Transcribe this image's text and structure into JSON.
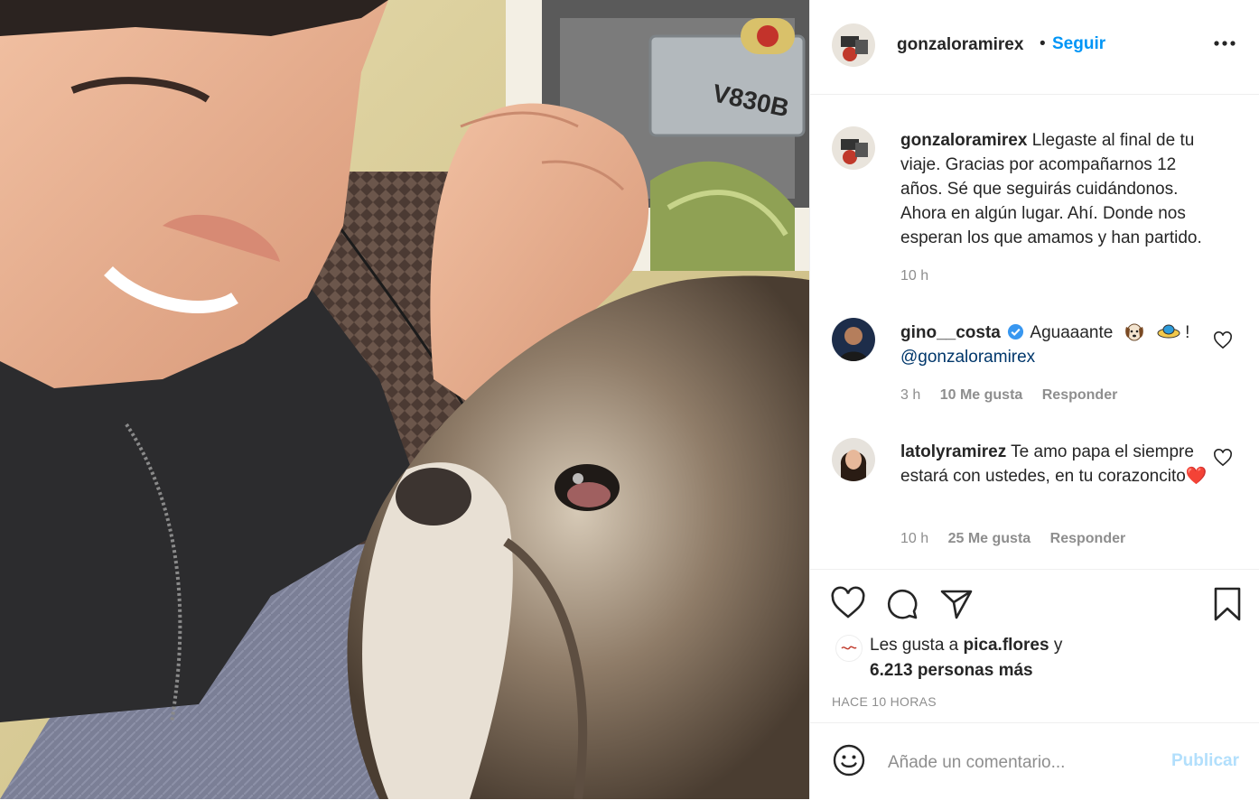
{
  "post": {
    "author": "gonzaloramirex",
    "separator": "•",
    "follow_label": "Seguir",
    "more_icon": "more-options-icon"
  },
  "caption": {
    "username": "gonzaloramirex",
    "text": "Llegaste al final de tu viaje. Gracias por acompañarnos 12 años. Sé que seguirás cuidándonos. Ahora en algún lugar. Ahí. Donde nos esperan los que amamos y han partido.",
    "time": "10 h"
  },
  "comments": [
    {
      "username": "gino__costa",
      "verified": true,
      "text": "Aguaaante",
      "emoji_end": "!",
      "mention": "@gonzaloramirex",
      "time": "3 h",
      "likes": "10 Me gusta",
      "reply": "Responder"
    },
    {
      "username": "latolyramirez",
      "text": "Te amo papa el siempre estará con ustedes, en tu corazoncito",
      "emoji": "❤️",
      "time": "10 h",
      "likes": "25 Me gusta",
      "reply": "Responder"
    }
  ],
  "likes": {
    "prefix": "Les gusta a",
    "user": "pica.flores",
    "conj": "y",
    "others": "6.213 personas más"
  },
  "timestamp": "HACE 10 HORAS",
  "add_comment": {
    "placeholder": "Añade un comentario...",
    "publish": "Publicar"
  },
  "photo_text": "V830B",
  "colors": {
    "link": "#0095f6",
    "publish_disabled": "#b2dffc",
    "muted": "#8e8e8e",
    "verified": "#3897f0",
    "heart_red": "#ed4956"
  }
}
